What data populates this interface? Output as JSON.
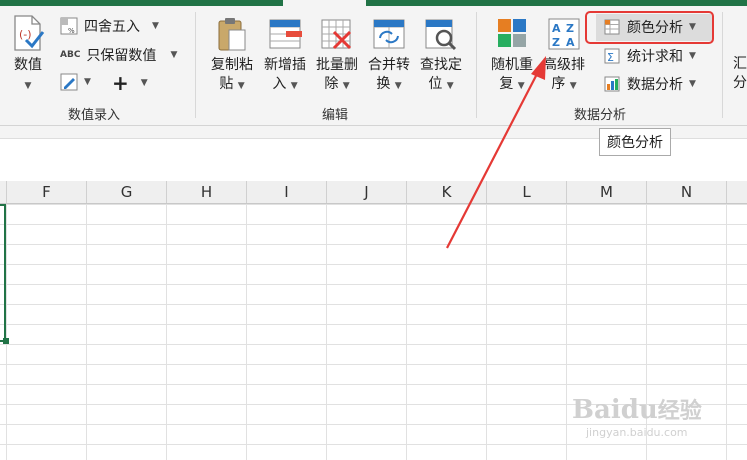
{
  "ribbon": {
    "numeric_group": {
      "label": "数值录入",
      "value_button": "数值",
      "round_button": "四舍五入",
      "keep_value_button": "只保留数值",
      "plus_glyph": "+"
    },
    "edit_group": {
      "label": "编辑",
      "buttons": [
        {
          "line1": "复制粘",
          "line2": "贴"
        },
        {
          "line1": "新增插",
          "line2": "入"
        },
        {
          "line1": "批量删",
          "line2": "除"
        },
        {
          "line1": "合并转",
          "line2": "换"
        },
        {
          "line1": "查找定",
          "line2": "位"
        }
      ]
    },
    "data_group": {
      "label": "数据分析",
      "random_repeat": {
        "line1": "随机重",
        "line2": "复"
      },
      "advanced_sort": {
        "line1": "高级排",
        "line2": "序"
      },
      "color_analysis": "颜色分析",
      "stat_sum": "统计求和",
      "data_analysis": "数据分析"
    },
    "cut_off_label": "汇",
    "cut_off_label2": "分"
  },
  "tooltip": {
    "text": "颜色分析"
  },
  "columns": [
    "F",
    "G",
    "H",
    "I",
    "J",
    "K",
    "L",
    "M",
    "N"
  ],
  "highlight_color": "#e53935",
  "accent": "#217346",
  "watermark": {
    "brand": "Baidu",
    "cn": "经验",
    "url": "jingyan.baidu.com"
  }
}
